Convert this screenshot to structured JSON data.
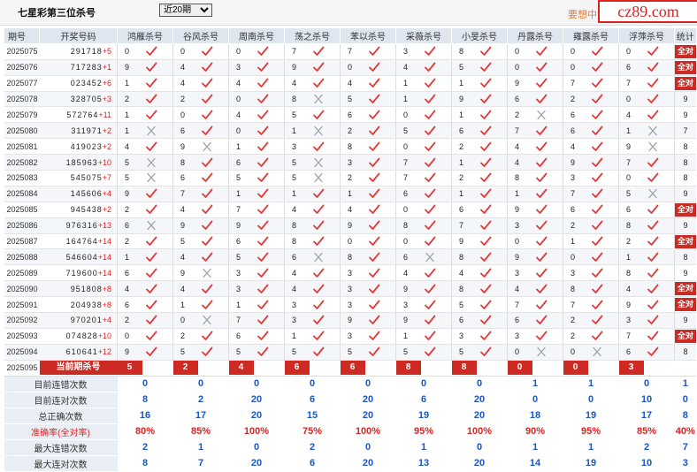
{
  "header": {
    "title": "七星彩第三位杀号",
    "period_select": "近20期",
    "promo_text": "要想中大",
    "brand": "cz89.com"
  },
  "table": {
    "col_period": "期号",
    "col_award": "开奖号码",
    "experts": [
      "鸿雁杀号",
      "谷风杀号",
      "周南杀号",
      "荡之杀号",
      "苯以杀号",
      "采薇杀号",
      "小旻杀号",
      "丹露杀号",
      "雍露杀号",
      "浮萍杀号"
    ],
    "col_stat": "统计",
    "rows": [
      {
        "period": "2025075",
        "award": "291718",
        "plus": "+5",
        "k": [
          0,
          0,
          0,
          7,
          7,
          3,
          8,
          0,
          0,
          0
        ],
        "r": [
          1,
          1,
          1,
          1,
          1,
          1,
          1,
          1,
          1,
          1
        ],
        "stat": "全对"
      },
      {
        "period": "2025076",
        "award": "717283",
        "plus": "+1",
        "k": [
          9,
          4,
          3,
          9,
          0,
          4,
          5,
          0,
          0,
          6
        ],
        "r": [
          1,
          1,
          1,
          1,
          1,
          1,
          1,
          1,
          1,
          1
        ],
        "stat": "全对"
      },
      {
        "period": "2025077",
        "award": "023452",
        "plus": "+6",
        "k": [
          1,
          4,
          4,
          4,
          4,
          1,
          1,
          9,
          7,
          7
        ],
        "r": [
          1,
          1,
          1,
          1,
          1,
          1,
          1,
          1,
          1,
          1
        ],
        "stat": "全对"
      },
      {
        "period": "2025078",
        "award": "328705",
        "plus": "+3",
        "k": [
          2,
          2,
          0,
          8,
          5,
          1,
          9,
          6,
          2,
          0
        ],
        "r": [
          1,
          1,
          1,
          0,
          1,
          1,
          1,
          1,
          1,
          1
        ],
        "stat": "9"
      },
      {
        "period": "2025079",
        "award": "572764",
        "plus": "+11",
        "k": [
          1,
          0,
          4,
          5,
          6,
          0,
          1,
          2,
          6,
          4
        ],
        "r": [
          1,
          1,
          1,
          1,
          1,
          1,
          1,
          0,
          1,
          1
        ],
        "stat": "9"
      },
      {
        "period": "2025080",
        "award": "311971",
        "plus": "+2",
        "k": [
          1,
          6,
          0,
          1,
          2,
          5,
          6,
          7,
          6,
          1
        ],
        "r": [
          0,
          1,
          1,
          0,
          1,
          1,
          1,
          1,
          1,
          0
        ],
        "stat": "7"
      },
      {
        "period": "2025081",
        "award": "419023",
        "plus": "+2",
        "k": [
          4,
          9,
          1,
          3,
          8,
          0,
          2,
          4,
          4,
          9
        ],
        "r": [
          1,
          0,
          1,
          1,
          1,
          1,
          1,
          1,
          1,
          0
        ],
        "stat": "8"
      },
      {
        "period": "2025082",
        "award": "185963",
        "plus": "+10",
        "k": [
          5,
          8,
          6,
          5,
          3,
          7,
          1,
          4,
          9,
          7
        ],
        "r": [
          0,
          1,
          1,
          0,
          1,
          1,
          1,
          1,
          1,
          1
        ],
        "stat": "8"
      },
      {
        "period": "2025083",
        "award": "545075",
        "plus": "+7",
        "k": [
          5,
          6,
          5,
          5,
          2,
          7,
          2,
          8,
          3,
          0
        ],
        "r": [
          0,
          1,
          1,
          0,
          1,
          1,
          1,
          1,
          1,
          1
        ],
        "stat": "8"
      },
      {
        "period": "2025084",
        "award": "145606",
        "plus": "+4",
        "k": [
          9,
          7,
          1,
          1,
          1,
          6,
          1,
          1,
          7,
          5
        ],
        "r": [
          1,
          1,
          1,
          1,
          1,
          1,
          1,
          1,
          1,
          0
        ],
        "stat": "9"
      },
      {
        "period": "2025085",
        "award": "945438",
        "plus": "+2",
        "k": [
          2,
          4,
          7,
          4,
          4,
          0,
          6,
          9,
          6,
          6
        ],
        "r": [
          1,
          1,
          1,
          1,
          1,
          1,
          1,
          1,
          1,
          1
        ],
        "stat": "全对"
      },
      {
        "period": "2025086",
        "award": "976316",
        "plus": "+13",
        "k": [
          6,
          9,
          9,
          8,
          9,
          8,
          7,
          3,
          2,
          8
        ],
        "r": [
          0,
          1,
          1,
          1,
          1,
          1,
          1,
          1,
          1,
          1
        ],
        "stat": "9"
      },
      {
        "period": "2025087",
        "award": "164764",
        "plus": "+14",
        "k": [
          2,
          5,
          6,
          8,
          0,
          0,
          9,
          0,
          1,
          2
        ],
        "r": [
          1,
          1,
          1,
          1,
          1,
          1,
          1,
          1,
          1,
          1
        ],
        "stat": "全对"
      },
      {
        "period": "2025088",
        "award": "546604",
        "plus": "+14",
        "k": [
          1,
          4,
          5,
          6,
          8,
          6,
          8,
          9,
          0,
          1
        ],
        "r": [
          1,
          1,
          1,
          0,
          1,
          0,
          1,
          1,
          1,
          1
        ],
        "stat": "8"
      },
      {
        "period": "2025089",
        "award": "719600",
        "plus": "+14",
        "k": [
          6,
          9,
          3,
          4,
          3,
          4,
          4,
          3,
          3,
          8
        ],
        "r": [
          1,
          0,
          1,
          1,
          1,
          1,
          1,
          1,
          1,
          1
        ],
        "stat": "9"
      },
      {
        "period": "2025090",
        "award": "951808",
        "plus": "+8",
        "k": [
          4,
          4,
          3,
          4,
          3,
          9,
          8,
          4,
          8,
          4
        ],
        "r": [
          1,
          1,
          1,
          1,
          1,
          1,
          1,
          1,
          1,
          1
        ],
        "stat": "全对"
      },
      {
        "period": "2025091",
        "award": "204938",
        "plus": "+8",
        "k": [
          6,
          1,
          1,
          3,
          3,
          3,
          5,
          7,
          7,
          9
        ],
        "r": [
          1,
          1,
          1,
          1,
          1,
          1,
          1,
          1,
          1,
          1
        ],
        "stat": "全对"
      },
      {
        "period": "2025092",
        "award": "970201",
        "plus": "+4",
        "k": [
          2,
          0,
          7,
          3,
          9,
          9,
          6,
          6,
          2,
          3
        ],
        "r": [
          1,
          0,
          1,
          1,
          1,
          1,
          1,
          1,
          1,
          1
        ],
        "stat": "9"
      },
      {
        "period": "2025093",
        "award": "074828",
        "plus": "+10",
        "k": [
          0,
          2,
          6,
          1,
          3,
          1,
          3,
          3,
          2,
          7
        ],
        "r": [
          1,
          1,
          1,
          1,
          1,
          1,
          1,
          1,
          1,
          1
        ],
        "stat": "全对"
      },
      {
        "period": "2025094",
        "award": "610641",
        "plus": "+12",
        "k": [
          9,
          5,
          5,
          5,
          5,
          5,
          5,
          0,
          0,
          6
        ],
        "r": [
          1,
          1,
          1,
          1,
          1,
          1,
          1,
          0,
          0,
          1
        ],
        "stat": "8"
      }
    ],
    "current": {
      "period": "2025095",
      "label": "当前期杀号",
      "kills": [
        "5",
        "2",
        "4",
        "6",
        "6",
        "8",
        "8",
        "0",
        "0",
        "3"
      ]
    },
    "summary": [
      {
        "label": "目前连错次数",
        "values": [
          "0",
          "0",
          "0",
          "0",
          "0",
          "0",
          "0",
          "1",
          "1",
          "0"
        ],
        "total": "1",
        "pct": false
      },
      {
        "label": "目前连对次数",
        "values": [
          "8",
          "2",
          "20",
          "6",
          "20",
          "6",
          "20",
          "0",
          "0",
          "10"
        ],
        "total": "0",
        "pct": false
      },
      {
        "label": "总正确次数",
        "values": [
          "16",
          "17",
          "20",
          "15",
          "20",
          "19",
          "20",
          "18",
          "19",
          "17"
        ],
        "total": "8",
        "pct": false
      },
      {
        "label": "准确率(全对率)",
        "values": [
          "80%",
          "85%",
          "100%",
          "75%",
          "100%",
          "95%",
          "100%",
          "90%",
          "95%",
          "85%"
        ],
        "total": "40%",
        "pct": true
      },
      {
        "label": "最大连错次数",
        "values": [
          "2",
          "1",
          "0",
          "2",
          "0",
          "1",
          "0",
          "1",
          "1",
          "2"
        ],
        "total": "7",
        "pct": false
      },
      {
        "label": "最大连对次数",
        "values": [
          "8",
          "7",
          "20",
          "6",
          "20",
          "13",
          "20",
          "14",
          "19",
          "10"
        ],
        "total": "3",
        "pct": false
      }
    ]
  }
}
